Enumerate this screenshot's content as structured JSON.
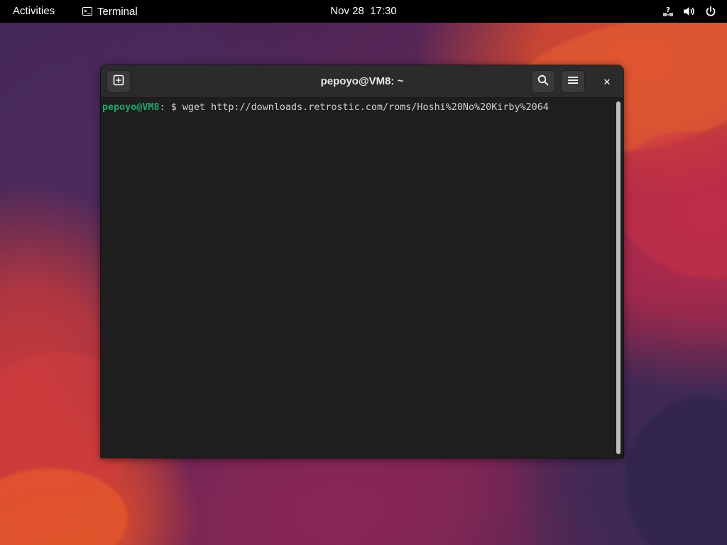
{
  "topbar": {
    "activities_label": "Activities",
    "app_name": "Terminal",
    "app_icon": "terminal-icon",
    "clock": "Nov 28  17:30",
    "tray_icons": [
      "network-unknown-icon",
      "volume-icon",
      "power-icon"
    ]
  },
  "window": {
    "title": "pepoyo@VM8: ~",
    "buttons": {
      "new_tab_icon": "new-tab-icon",
      "search_icon": "search-icon",
      "menu_icon": "hamburger-menu-icon",
      "close_label": "✕"
    }
  },
  "terminal": {
    "prompt_user_host": "pepoyo@VM8",
    "prompt_path_suffix": ": $ ",
    "command": "wget http://downloads.retrostic.com/roms/Hoshi%20No%20Kirby%2064"
  },
  "colors": {
    "prompt_green": "#26a269",
    "terminal_bg": "#1e1e1e",
    "headerbar_bg": "#2b2b2b"
  }
}
